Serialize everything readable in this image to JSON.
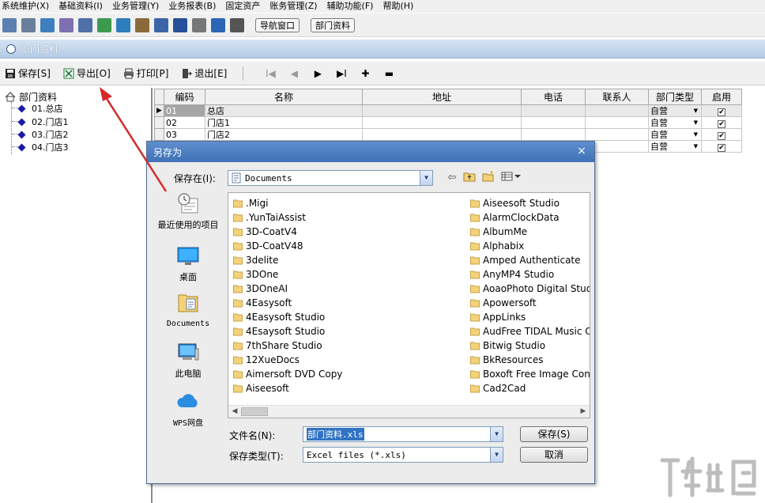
{
  "menu": [
    "系统维护(X)",
    "基础资料(I)",
    "业务管理(Y)",
    "业务报表(B)",
    "固定资产",
    "账务管理(Z)",
    "辅助功能(F)",
    "帮助(H)"
  ],
  "toolbar": {
    "buttons": [
      "导航窗口",
      "部门资料"
    ],
    "icon_colors": [
      "#5b7fb0",
      "#6a7f9c",
      "#3f7fbf",
      "#7d6fb0",
      "#4f6fa8",
      "#3c9a4f",
      "#2e7dbd",
      "#8a6a3a",
      "#3b65a8",
      "#27509a",
      "#777777",
      "#2a66b5",
      "#555555"
    ]
  },
  "window": {
    "title": "部门资料"
  },
  "actions": {
    "save": "保存[S]",
    "export": "导出[O]",
    "print": "打印[P]",
    "exit": "退出[E]",
    "nav": [
      "I◀",
      "◀",
      "▶",
      "▶I",
      "✚",
      "▬"
    ]
  },
  "tree": {
    "root": "部门资料",
    "items": [
      "01.总店",
      "02.门店1",
      "03.门店2",
      "04.门店3"
    ]
  },
  "grid": {
    "columns": [
      "",
      "编码",
      "名称",
      "地址",
      "电话",
      "联系人",
      "部门类型",
      "启用"
    ],
    "rows": [
      {
        "indicator": "▶",
        "code": "01",
        "name": "总店",
        "address": "",
        "phone": "",
        "contact": "",
        "type": "自营",
        "enabled": "✔"
      },
      {
        "indicator": "",
        "code": "02",
        "name": "门店1",
        "address": "",
        "phone": "",
        "contact": "",
        "type": "自营",
        "enabled": "✔"
      },
      {
        "indicator": "",
        "code": "03",
        "name": "门店2",
        "address": "",
        "phone": "",
        "contact": "",
        "type": "自营",
        "enabled": "✔"
      },
      {
        "indicator": "",
        "code": "",
        "name": "",
        "address": "",
        "phone": "",
        "contact": "",
        "type": "自营",
        "enabled": "✔"
      }
    ]
  },
  "dialog": {
    "title": "另存为",
    "close": "×",
    "save_in_label": "保存在(I):",
    "save_in_value": "Documents",
    "places": [
      "最近使用的项目",
      "桌面",
      "Documents",
      "此电脑",
      "WPS网盘"
    ],
    "files_col1": [
      ".Migi",
      ".YunTaiAssist",
      "3D-CoatV4",
      "3D-CoatV48",
      "3delite",
      "3DOne",
      "3DOneAI",
      "4Easysoft",
      "4Easysoft Studio",
      "4Esaysoft Studio",
      "7thShare Studio",
      "12XueDocs",
      "Aimersoft DVD Copy",
      "Aiseesoft"
    ],
    "files_col2": [
      "Aiseesoft Studio",
      "AlarmClockData",
      "AlbumMe",
      "Alphabix",
      "Amped Authenticate",
      "AnyMP4 Studio",
      "AoaoPhoto Digital Studio",
      "Apowersoft",
      "AppLinks",
      "AudFree TIDAL Music Converter",
      "Bitwig Studio",
      "BkResources",
      "Boxoft Free Image Converter",
      "Cad2Cad"
    ],
    "filename_label": "文件名(N):",
    "filename_value": "部门资料.xls",
    "filetype_label": "保存类型(T):",
    "filetype_value": "Excel files (*.xls)",
    "save_button": "保存(S)",
    "cancel_button": "取消"
  },
  "colors": {
    "arrow": "#d42a2a",
    "dialog_title": "#4a7cc0",
    "folder": "#f3d27a",
    "title_strip": "#c5d7ee"
  }
}
